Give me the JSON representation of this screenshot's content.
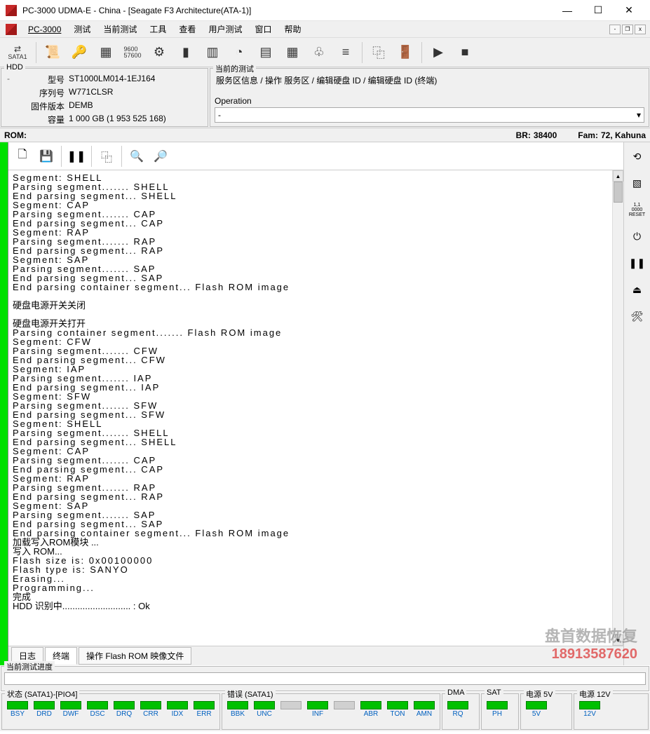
{
  "titlebar": {
    "title": "PC-3000 UDMA-E - China - [Seagate F3 Architecture(ATA-1)]"
  },
  "menubar": {
    "app": "PC-3000",
    "items": [
      "测试",
      "当前测试",
      "工具",
      "查看",
      "用户测试",
      "窗口",
      "帮助"
    ]
  },
  "toolbar": {
    "sata": "SATA1"
  },
  "hdd": {
    "header": "HDD",
    "model_lbl": "型号",
    "model": "ST1000LM014-1EJ164",
    "serial_lbl": "序列号",
    "serial": "W771CLSR",
    "fw_lbl": "固件版本",
    "fw": "DEMB",
    "cap_lbl": "容量",
    "cap": "1 000 GB (1 953 525 168)"
  },
  "path": {
    "header": "当前的测试",
    "breadcrumb": "服务区信息 / 操作 服务区 / 编辑硬盘 ID / 编辑硬盘 ID (终端)",
    "operation_lbl": "Operation",
    "operation_val": "-"
  },
  "romline": {
    "rom_lbl": "ROM:",
    "br_lbl": "BR:",
    "br_val": "38400",
    "fam_lbl": "Fam:",
    "fam_val": "72, Kahuna"
  },
  "log_lines": [
    "Segment: SHELL",
    "Parsing segment....... SHELL",
    "End parsing segment... SHELL",
    "Segment: CAP",
    "Parsing segment....... CAP",
    "End parsing segment... CAP",
    "Segment: RAP",
    "Parsing segment....... RAP",
    "End parsing segment... RAP",
    "Segment: SAP",
    "Parsing segment....... SAP",
    "End parsing segment... SAP",
    "End parsing container segment... Flash ROM image",
    "",
    "硬盘电源开关关闭",
    "",
    "硬盘电源开关打开",
    "Parsing container segment....... Flash ROM image",
    "Segment: CFW",
    "Parsing segment....... CFW",
    "End parsing segment... CFW",
    "Segment: IAP",
    "Parsing segment....... IAP",
    "End parsing segment... IAP",
    "Segment: SFW",
    "Parsing segment....... SFW",
    "End parsing segment... SFW",
    "Segment: SHELL",
    "Parsing segment....... SHELL",
    "End parsing segment... SHELL",
    "Segment: CAP",
    "Parsing segment....... CAP",
    "End parsing segment... CAP",
    "Segment: RAP",
    "Parsing segment....... RAP",
    "End parsing segment... RAP",
    "Segment: SAP",
    "Parsing segment....... SAP",
    "End parsing segment... SAP",
    "End parsing container segment... Flash ROM image",
    "加载写入ROM模块 ...",
    "写入 ROM...",
    "Flash size is: 0x00100000",
    "Flash type is: SANYO",
    "Erasing...",
    "Programming...",
    "完成",
    "HDD 识别中........................... : Ok"
  ],
  "tabs": [
    "日志",
    "终端",
    "操作 Flash ROM 映像文件"
  ],
  "active_tab": 1,
  "progress": {
    "label": "当前测试进度"
  },
  "status": {
    "state_title": "状态 (SATA1)-[PIO4]",
    "state_items": [
      "BSY",
      "DRD",
      "DWF",
      "DSC",
      "DRQ",
      "CRR",
      "IDX",
      "ERR"
    ],
    "err_title": "错误 (SATA1)",
    "err_items": [
      "BBK",
      "UNC",
      "",
      "INF",
      "",
      "ABR",
      "TON",
      "AMN"
    ],
    "dma_title": "DMA",
    "dma_items": [
      "RQ"
    ],
    "sat_title": "SAT",
    "sat_items": [
      "PH"
    ],
    "p5_title": "电源 5V",
    "p5_items": [
      "5V"
    ],
    "p12_title": "电源 12V",
    "p12_items": [
      "12V"
    ]
  },
  "side_tools": [
    "reset-icon",
    "register-icon",
    "power-icon",
    "pause-icon",
    "eject-icon",
    "tools-icon"
  ],
  "watermark": {
    "line1": "盘首数据恢复",
    "line2": "18913587620"
  }
}
